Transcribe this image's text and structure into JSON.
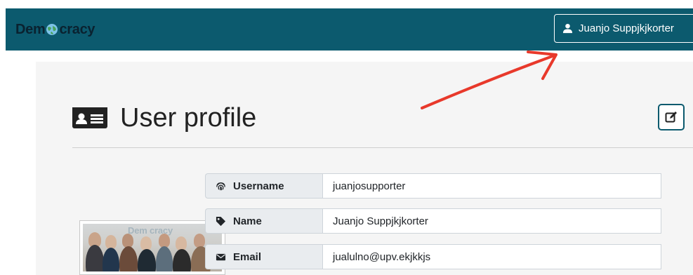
{
  "navbar": {
    "brand_prefix": "Dem",
    "brand_suffix": "cracy",
    "user_button_label": "Juanjo Suppjkjkorter"
  },
  "page": {
    "title": "User profile"
  },
  "photo": {
    "logo_text": "Dem cracy"
  },
  "profile": {
    "rows": [
      {
        "label": "Username",
        "value": "juanjosupporter",
        "icon": "fingerprint-icon"
      },
      {
        "label": "Name",
        "value": "Juanjo Suppjkjkorter",
        "icon": "tag-icon"
      },
      {
        "label": "Email",
        "value": "jualulno@upv.ekjkkjs",
        "icon": "envelope-icon"
      }
    ]
  },
  "colors": {
    "navbar": "#0c5a6e",
    "annotation_arrow": "#e8392b"
  }
}
